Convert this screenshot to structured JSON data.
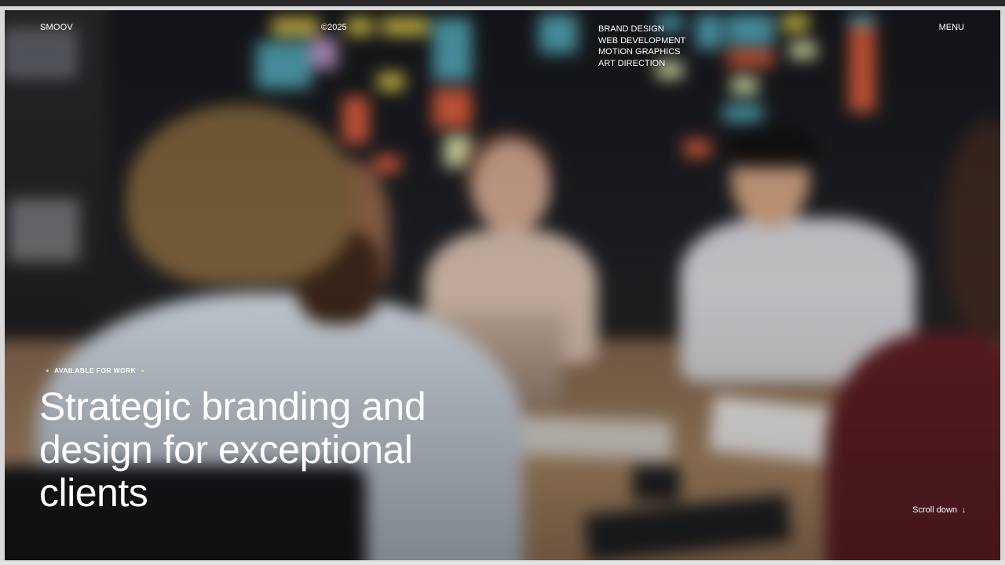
{
  "header": {
    "logo": "SMOOV",
    "year": "©2025",
    "services": [
      "BRAND DESIGN",
      "WEB DEVELOPMENT",
      "MOTION GRAPHICS",
      "ART DIRECTION"
    ],
    "menu_label": "MENU"
  },
  "hero": {
    "badge": "AVAILABLE FOR WORK",
    "headline": "Strategic branding and design for exceptional clients",
    "scroll_label": "Scroll down",
    "scroll_icon": "arrow-down-icon"
  },
  "colors": {
    "text": "#ffffff",
    "accent_dot": "#c8f560"
  }
}
